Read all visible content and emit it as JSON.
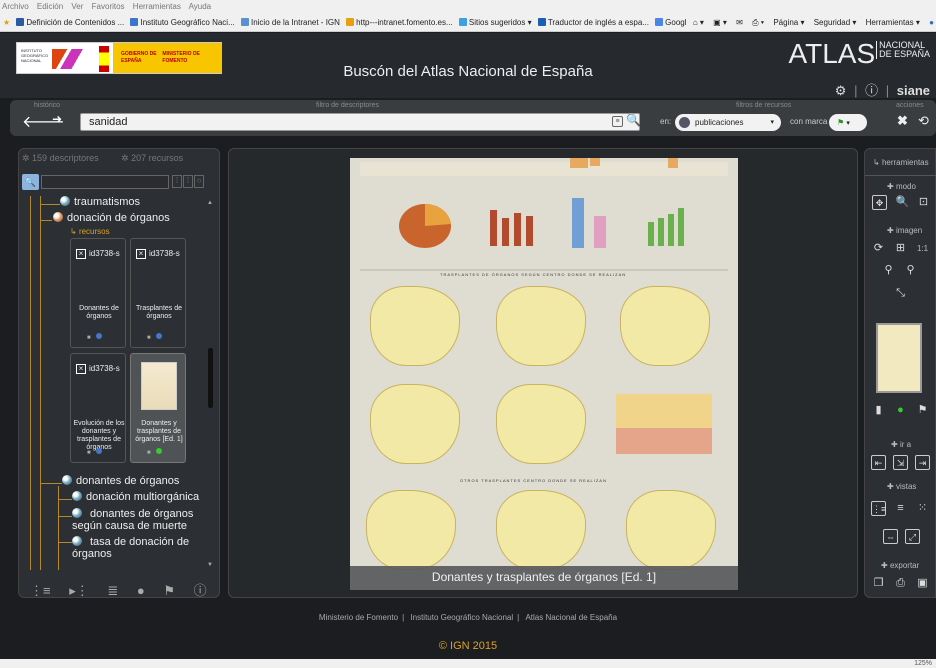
{
  "browser": {
    "menu": [
      "Archivo",
      "Edición",
      "Ver",
      "Favoritos",
      "Herramientas",
      "Ayuda"
    ],
    "favorites": [
      {
        "label": "Definición de Contenidos ...",
        "color": "#2c5aa0"
      },
      {
        "label": "Instituto Geográfico Naci...",
        "color": "#3a77c8"
      },
      {
        "label": "Inicio de la Intranet - IGN",
        "color": "#5a8fd0"
      },
      {
        "label": "http---intranet.fomento.es...",
        "color": "#e8a010"
      },
      {
        "label": "Sitios sugeridos ▾",
        "color": "#3da0e0"
      },
      {
        "label": "Traductor de inglés a espa...",
        "color": "#1a5fb4"
      },
      {
        "label": "Google",
        "color": "#4a86e8"
      }
    ],
    "tools": [
      "Página ▾",
      "Seguridad ▾",
      "Herramientas ▾"
    ],
    "zoom": "125%"
  },
  "header": {
    "logo_ign": "INSTITUTO GEOGRÁFICO NACIONAL",
    "gobierno": "GOBIERNO DE ESPAÑA",
    "ministerio": "MINISTERIO DE FOMENTO",
    "title": "Buscón del Atlas Nacional de España",
    "brand_main": "ATLAS",
    "brand_sub1": "NACIONAL",
    "brand_sub2": "DE ESPAÑA",
    "user": "siane"
  },
  "toolbar": {
    "historico_label": "histórico",
    "filtro_label": "filtro de descriptores",
    "filtros_recursos_label": "filtros de recursos",
    "acciones_label": "acciones",
    "search_value": "sanidad",
    "en_label": "en:",
    "scope_value": "publicaciones",
    "marca_label": "con marca"
  },
  "left": {
    "descriptores": "159 descriptores",
    "recursos": "207 recursos",
    "tree": {
      "traumatismos": "traumatismos",
      "donacion": "donación de órganos",
      "recursos_label": "recursos",
      "donantes": "donantes de órganos",
      "multiorganica": "donación multiorgánica",
      "causa_muerte": "donantes de órganos según causa de muerte",
      "tasa": "tasa de donación de órganos"
    },
    "cards": [
      {
        "id": "id3738-s",
        "title": "Donantes de órganos"
      },
      {
        "id": "id3738-s",
        "title": "Trasplantes de órganos"
      },
      {
        "id": "id3738-s",
        "title": "Evolución de los donantes y trasplantes de órganos"
      },
      {
        "id": "",
        "title": "Donantes y trasplantes de órganos [Ed. 1]"
      }
    ]
  },
  "viewer": {
    "caption": "Donantes y trasplantes de órganos [Ed. 1]",
    "doc_heading1": "TRASPLANTES DE ÓRGANOS SEGÚN CENTRO DONDE SE REALIZAN",
    "doc_heading2": "OTROS TRASPLANTES CENTRO DONDE SE REALIZAN"
  },
  "right": {
    "herramientas": "herramientas",
    "modo": "modo",
    "imagen": "imagen",
    "scale": "1:1",
    "ira": "ir a",
    "vistas": "vistas",
    "exportar": "exportar"
  },
  "footer": {
    "links": [
      "Ministerio de Fomento",
      "Instituto Geográfico Nacional",
      "Atlas Nacional de España"
    ],
    "copyright": "© IGN 2015"
  }
}
